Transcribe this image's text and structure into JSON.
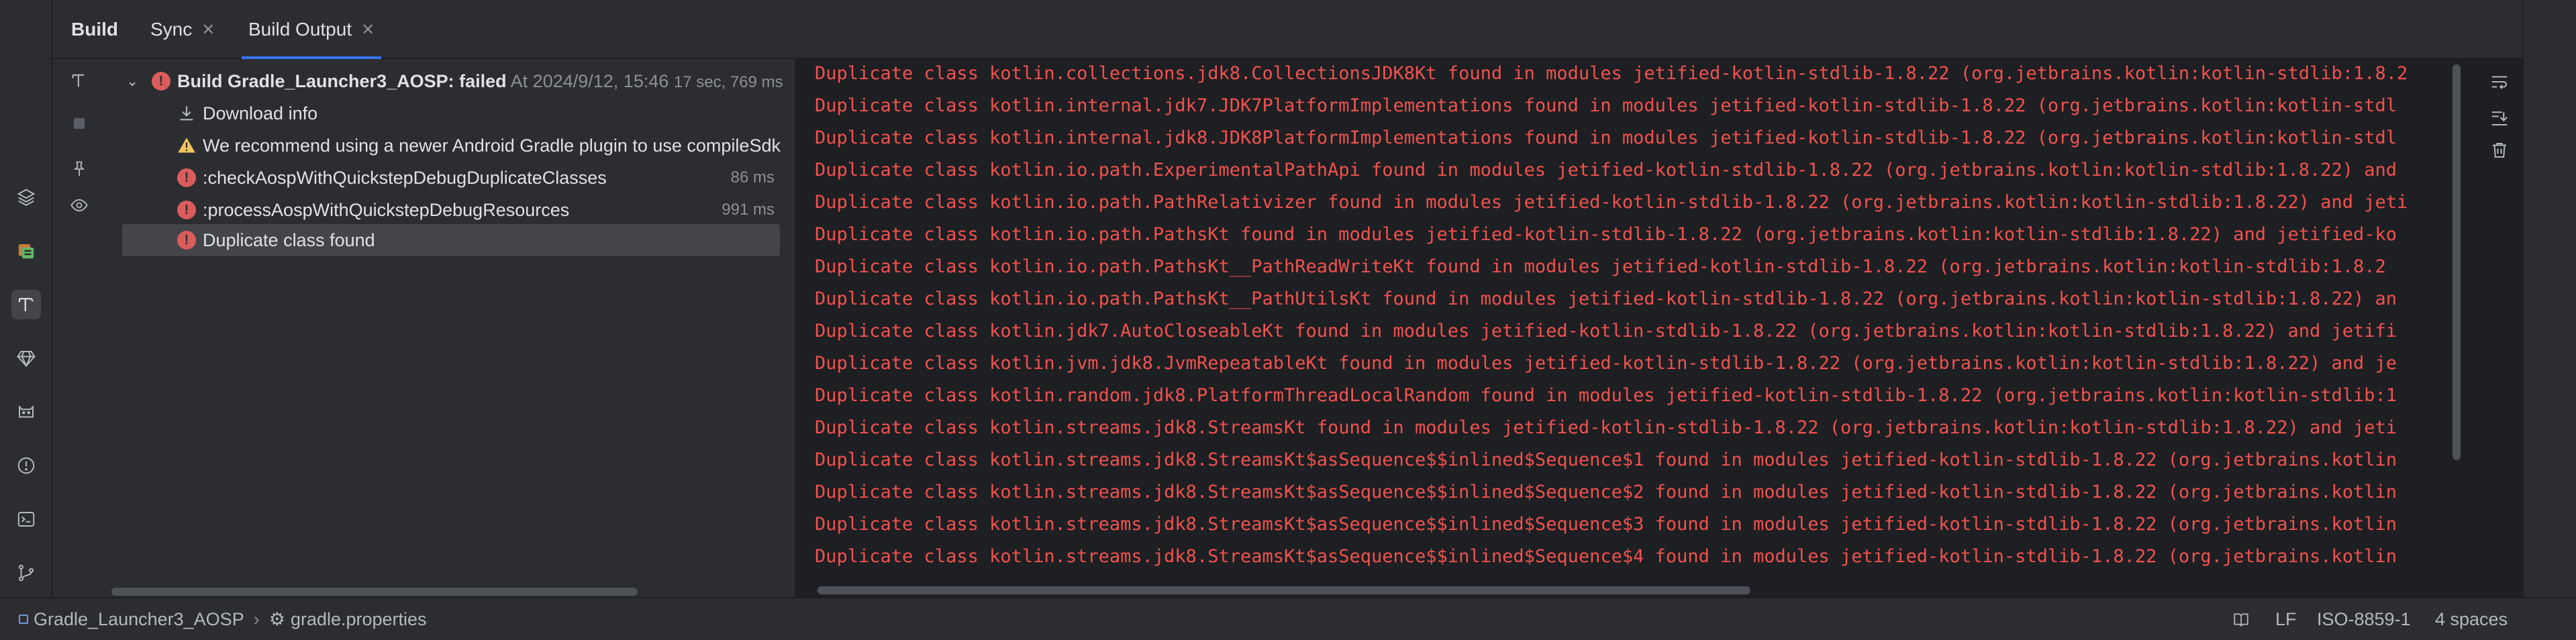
{
  "tabs": [
    {
      "label": "Build",
      "closable": false
    },
    {
      "label": "Sync",
      "closable": true
    },
    {
      "label": "Build Output",
      "closable": true
    }
  ],
  "tree": {
    "root": {
      "label": "Build Gradle_Launcher3_AOSP:",
      "status": "failed",
      "timestamp": "At 2024/9/12, 15:46",
      "duration": "17 sec, 769 ms"
    },
    "items": [
      {
        "label": "Download info",
        "icon": "download-icon",
        "duration": ""
      },
      {
        "label": "We recommend using a newer Android Gradle plugin to use compileSdk",
        "icon": "warning-icon",
        "duration": ""
      },
      {
        "label": ":checkAospWithQuickstepDebugDuplicateClasses",
        "icon": "error-icon",
        "duration": "86 ms"
      },
      {
        "label": ":processAospWithQuickstepDebugResources",
        "icon": "error-icon",
        "duration": "991 ms"
      },
      {
        "label": "Duplicate class found",
        "icon": "error-icon",
        "duration": ""
      }
    ]
  },
  "console": {
    "lines": [
      "Duplicate class kotlin.collections.jdk8.CollectionsJDK8Kt found in modules jetified-kotlin-stdlib-1.8.22 (org.jetbrains.kotlin:kotlin-stdlib:1.8.2",
      "Duplicate class kotlin.internal.jdk7.JDK7PlatformImplementations found in modules jetified-kotlin-stdlib-1.8.22 (org.jetbrains.kotlin:kotlin-stdl",
      "Duplicate class kotlin.internal.jdk8.JDK8PlatformImplementations found in modules jetified-kotlin-stdlib-1.8.22 (org.jetbrains.kotlin:kotlin-stdl",
      "Duplicate class kotlin.io.path.ExperimentalPathApi found in modules jetified-kotlin-stdlib-1.8.22 (org.jetbrains.kotlin:kotlin-stdlib:1.8.22) and",
      "Duplicate class kotlin.io.path.PathRelativizer found in modules jetified-kotlin-stdlib-1.8.22 (org.jetbrains.kotlin:kotlin-stdlib:1.8.22) and jeti",
      "Duplicate class kotlin.io.path.PathsKt found in modules jetified-kotlin-stdlib-1.8.22 (org.jetbrains.kotlin:kotlin-stdlib:1.8.22) and jetified-ko",
      "Duplicate class kotlin.io.path.PathsKt__PathReadWriteKt found in modules jetified-kotlin-stdlib-1.8.22 (org.jetbrains.kotlin:kotlin-stdlib:1.8.2",
      "Duplicate class kotlin.io.path.PathsKt__PathUtilsKt found in modules jetified-kotlin-stdlib-1.8.22 (org.jetbrains.kotlin:kotlin-stdlib:1.8.22) an",
      "Duplicate class kotlin.jdk7.AutoCloseableKt found in modules jetified-kotlin-stdlib-1.8.22 (org.jetbrains.kotlin:kotlin-stdlib:1.8.22) and jetifi",
      "Duplicate class kotlin.jvm.jdk8.JvmRepeatableKt found in modules jetified-kotlin-stdlib-1.8.22 (org.jetbrains.kotlin:kotlin-stdlib:1.8.22) and je",
      "Duplicate class kotlin.random.jdk8.PlatformThreadLocalRandom found in modules jetified-kotlin-stdlib-1.8.22 (org.jetbrains.kotlin:kotlin-stdlib:1",
      "Duplicate class kotlin.streams.jdk8.StreamsKt found in modules jetified-kotlin-stdlib-1.8.22 (org.jetbrains.kotlin:kotlin-stdlib:1.8.22) and jeti",
      "Duplicate class kotlin.streams.jdk8.StreamsKt$asSequence$$inlined$Sequence$1 found in modules jetified-kotlin-stdlib-1.8.22 (org.jetbrains.kotlin",
      "Duplicate class kotlin.streams.jdk8.StreamsKt$asSequence$$inlined$Sequence$2 found in modules jetified-kotlin-stdlib-1.8.22 (org.jetbrains.kotlin",
      "Duplicate class kotlin.streams.jdk8.StreamsKt$asSequence$$inlined$Sequence$3 found in modules jetified-kotlin-stdlib-1.8.22 (org.jetbrains.kotlin",
      "Duplicate class kotlin.streams.jdk8.StreamsKt$asSequence$$inlined$Sequence$4 found in modules jetified-kotlin-stdlib-1.8.22 (org.jetbrains.kotlin"
    ]
  },
  "statusbar": {
    "project": "Gradle_Launcher3_AOSP",
    "file": "gradle.properties",
    "line_separator": "LF",
    "encoding": "ISO-8859-1",
    "indent": "4 spaces"
  },
  "colors": {
    "accent": "#3574f0",
    "error": "#f0524f",
    "error_icon": "#db5c5c",
    "warning": "#f2c55c"
  }
}
